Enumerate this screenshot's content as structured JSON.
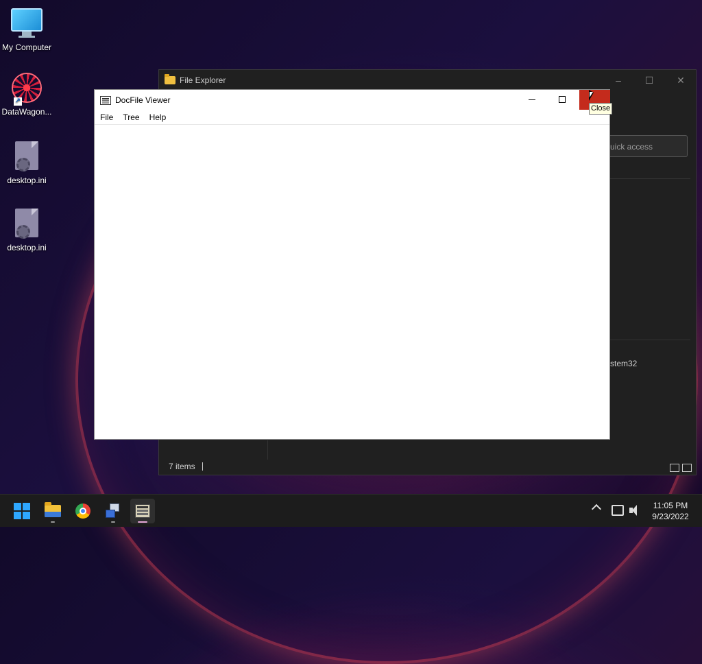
{
  "desktop": {
    "icons": [
      {
        "label": "My Computer",
        "icon": "monitor-icon"
      },
      {
        "label": "DataWagon...",
        "icon": "mandala-shortcut-icon"
      },
      {
        "label": "desktop.ini",
        "icon": "settings-file-icon"
      },
      {
        "label": "desktop.ini",
        "icon": "settings-file-icon"
      }
    ]
  },
  "explorer": {
    "title": "File Explorer",
    "quick_access_text": "uick access",
    "partial_item": "stem32",
    "status_items": "7 items"
  },
  "docfile_viewer": {
    "title": "DocFile Viewer",
    "menu": [
      "File",
      "Tree",
      "Help"
    ],
    "tooltip": "Close"
  },
  "taskbar": {
    "apps": [
      "start-icon",
      "file-explorer-icon",
      "chrome-icon",
      "network-app-icon",
      "docfile-viewer-icon"
    ],
    "time": "11:05 PM",
    "date": "9/23/2022"
  },
  "colors": {
    "close_button": "#c42b1c",
    "accent": "#2ea7ff"
  }
}
